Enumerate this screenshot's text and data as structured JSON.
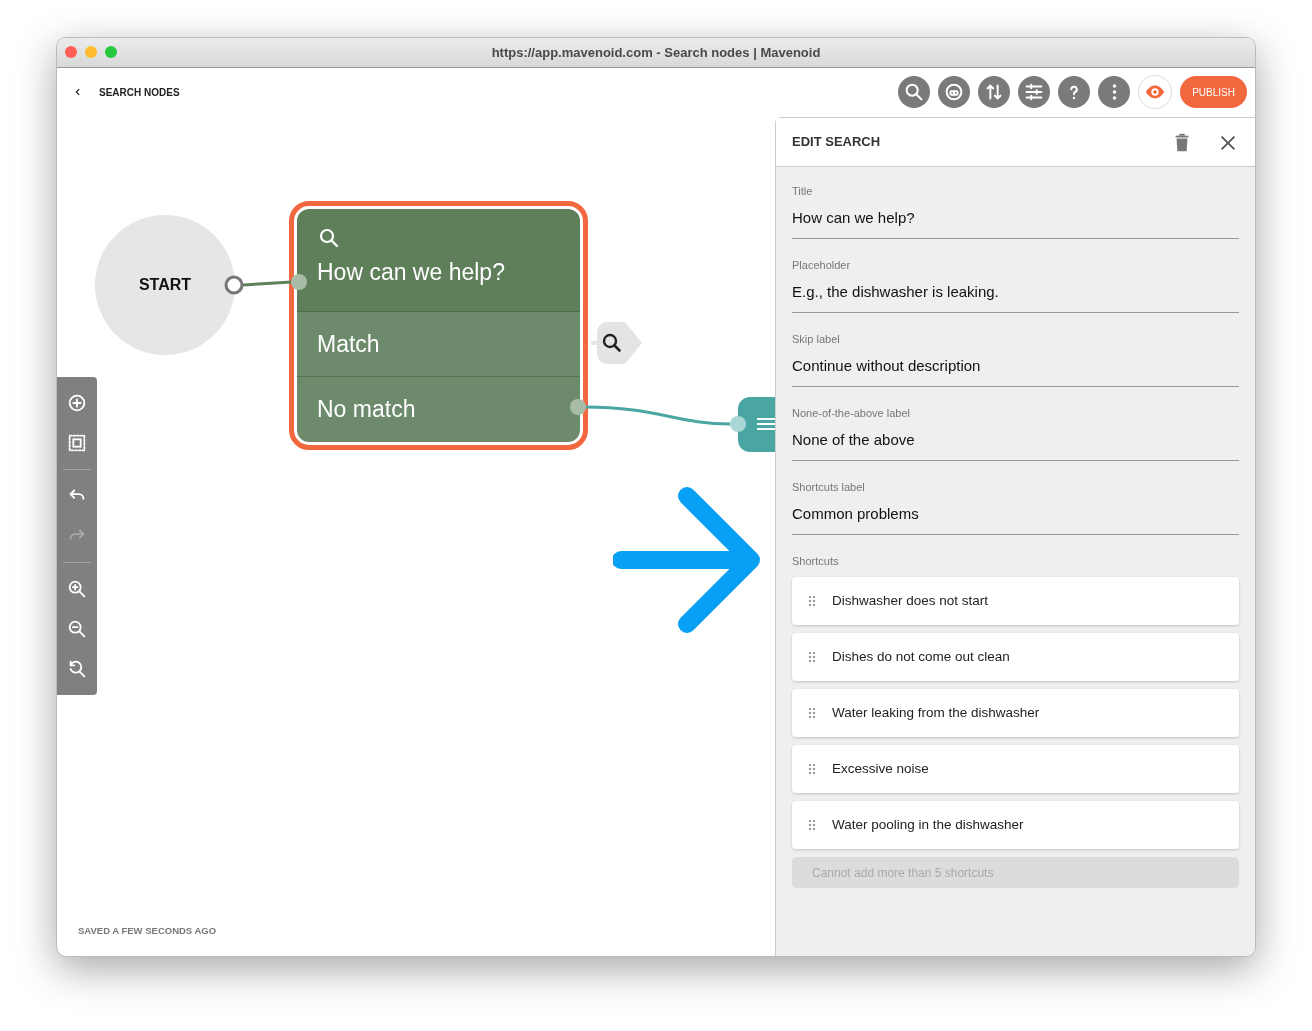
{
  "window": {
    "title": "https://app.mavenoid.com - Search nodes | Mavenoid"
  },
  "header": {
    "back_label": "SEARCH NODES",
    "tools": [
      {
        "kind": "search"
      },
      {
        "kind": "bot"
      },
      {
        "kind": "sort"
      },
      {
        "kind": "sliders"
      },
      {
        "kind": "help"
      },
      {
        "kind": "more"
      },
      {
        "kind": "preview"
      }
    ],
    "publish_label": "PUBLISH"
  },
  "canvas": {
    "start_label": "START",
    "search_node": {
      "title": "How can we help?",
      "selected": true,
      "outputs": [
        {
          "label": "Match",
          "connected": false
        },
        {
          "label": "No match",
          "connected": true
        }
      ]
    },
    "tools": [
      {
        "kind": "add",
        "disabled": false
      },
      {
        "kind": "select",
        "disabled": false
      },
      {
        "kind": "undo",
        "disabled": false
      },
      {
        "kind": "redo",
        "disabled": true
      },
      {
        "kind": "zoom-in",
        "disabled": false
      },
      {
        "kind": "zoom-out",
        "disabled": false
      },
      {
        "kind": "zoom-reset",
        "disabled": false
      }
    ],
    "status": "SAVED A FEW SECONDS AGO"
  },
  "panel": {
    "title": "EDIT SEARCH",
    "fields": [
      {
        "label": "Title",
        "value": "How can we help?"
      },
      {
        "label": "Placeholder",
        "value": "E.g., the dishwasher is leaking."
      },
      {
        "label": "Skip label",
        "value": "Continue without description"
      },
      {
        "label": "None-of-the-above label",
        "value": "None of the above"
      },
      {
        "label": "Shortcuts label",
        "value": "Common problems"
      }
    ],
    "shortcuts_label": "Shortcuts",
    "shortcuts": [
      "Dishwasher does not start",
      "Dishes do not come out clean",
      "Water leaking from the dishwasher",
      "Excessive noise",
      "Water pooling in the dishwasher"
    ],
    "add_button": {
      "label": "Cannot add more than 5 shortcuts",
      "disabled": true
    }
  }
}
